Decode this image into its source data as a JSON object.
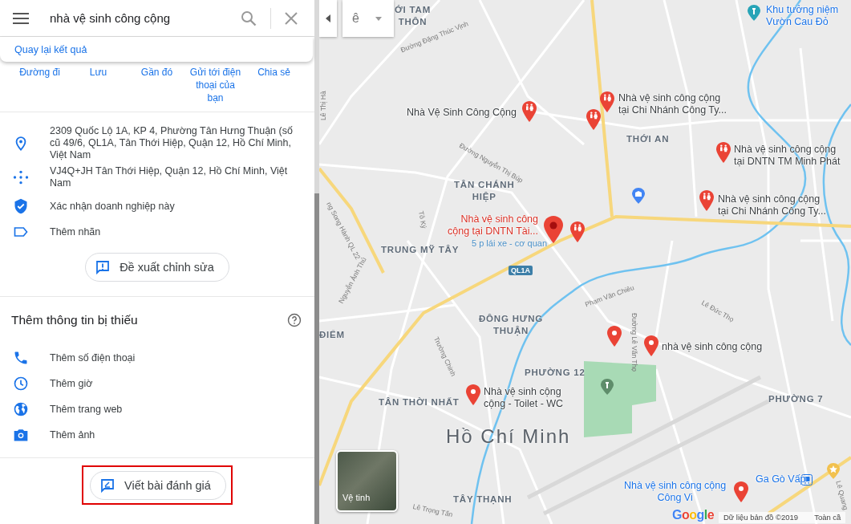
{
  "search": {
    "value": "nhà vệ sinh công cộng"
  },
  "back_link": "Quay lại kết quả",
  "actions": [
    "Đường đi",
    "Lưu",
    "Gần đó",
    "Gửi tới điện thoại của bạn",
    "Chia sẻ"
  ],
  "info_rows": [
    {
      "kind": "address",
      "text": "2309 Quốc Lộ 1A, KP 4, Phường Tân Hưng Thuận (số cũ 49/6, QL1A, Tân Thới Hiệp, Quận 12, Hồ Chí Minh, Việt Nam"
    },
    {
      "kind": "plus_code",
      "text": "VJ4Q+JH Tân Thới Hiệp, Quận 12, Hồ Chí Minh, Việt Nam"
    },
    {
      "kind": "verify",
      "text": "Xác nhận doanh nghiệp này"
    },
    {
      "kind": "label",
      "text": "Thêm nhãn"
    }
  ],
  "suggest_edit_button": "Đề xuất chỉnh sửa",
  "missing_info": {
    "title": "Thêm thông tin bị thiếu",
    "items": [
      {
        "kind": "phone",
        "label": "Thêm số điện thoại"
      },
      {
        "kind": "hours",
        "label": "Thêm giờ"
      },
      {
        "kind": "website",
        "label": "Thêm trang web"
      },
      {
        "kind": "photo",
        "label": "Thêm ảnh"
      }
    ]
  },
  "review_button": "Viết bài đánh giá",
  "map": {
    "input_tool": "ê",
    "areas": [
      {
        "lines": [
          "ỚI TAM",
          "THÔN"
        ]
      },
      {
        "lines": [
          "THỚI AN"
        ]
      },
      {
        "lines": [
          "TÂN CHÁNH",
          "HIỆP"
        ]
      },
      {
        "lines": [
          "TRUNG MỸ TÂY"
        ]
      },
      {
        "lines": [
          "ĐIỂM"
        ]
      },
      {
        "lines": [
          "ĐÔNG HƯNG",
          "THUẬN"
        ]
      },
      {
        "lines": [
          "PHƯỜNG 12"
        ]
      },
      {
        "lines": [
          "TÂN THỜI NHẤT"
        ]
      },
      {
        "lines": [
          "PHƯỜNG 7"
        ]
      },
      {
        "lines": [
          "TÂY THẠNH"
        ]
      }
    ],
    "city": "Hồ Chí Minh",
    "streets": [
      "Đường Đặng Thúc Vịnh",
      "Lê Thị Hà",
      "Đường Nguyễn Thị Búp",
      "Tô Ký",
      "ng Song Hành QL 22",
      "Nguyễn Ảnh Thủ",
      "Trường Chinh",
      "Phạm Văn Chiêu",
      "Đường Lê Văn Thọ",
      "Lê Đức Thọ",
      "Lê Trọng Tấn",
      "Lê Quang"
    ],
    "highway_shield": "QL1A",
    "places": [
      {
        "kind": "toilet",
        "selected": false,
        "lines": [
          "Nhà Vệ Sinh Công Cộng"
        ],
        "color": "#3c4043"
      },
      {
        "kind": "toilet",
        "selected": false
      },
      {
        "kind": "toilet",
        "selected": false,
        "lines": [
          "Nhà vệ sinh công cộng",
          "tại Chi Nhánh Công Ty..."
        ],
        "color": "#3c4043"
      },
      {
        "kind": "toilet",
        "selected": false,
        "lines": [
          "Nhà vệ sinh công cộng",
          "tại DNTN TM Minh Phát"
        ],
        "color": "#3c4043"
      },
      {
        "kind": "toilet",
        "selected": false,
        "lines": [
          "Nhà vệ sinh công cộng",
          "tại Chi Nhánh Công Ty..."
        ],
        "color": "#3c4043"
      },
      {
        "kind": "dot",
        "selected": true,
        "lines": [
          "Nhà vệ sinh công",
          "cộng tại DNTN Tài..."
        ],
        "color": "#d93025",
        "note": "5 p lái xe - cơ quan"
      },
      {
        "kind": "toilet",
        "selected": false
      },
      {
        "kind": "dot",
        "selected": false
      },
      {
        "kind": "dot",
        "selected": false,
        "lines": [
          "nhà vệ sinh công cộng"
        ],
        "color": "#3c4043"
      },
      {
        "kind": "dot",
        "selected": false,
        "lines": [
          "Nhà vệ sinh cộng",
          "cộng - Toilet - WC"
        ],
        "color": "#3c4043"
      },
      {
        "kind": "dot",
        "selected": false,
        "lines": [
          "Nhà vệ sinh công cộng",
          "Công Vi"
        ],
        "color": "#1a73e8"
      },
      {
        "kind": "info",
        "selected": false
      },
      {
        "kind": "park",
        "selected": false
      },
      {
        "kind": "landmark",
        "selected": false,
        "lines": [
          "Khu tưởng niệm",
          "Vườn Cau Đỏ"
        ],
        "color": "#1a73e8"
      },
      {
        "kind": "station",
        "selected": false,
        "lines": [
          "Ga Gò Vấp"
        ],
        "color": "#1a73e8"
      },
      {
        "kind": "star",
        "selected": false
      }
    ],
    "satellite_label": "Vệ tinh",
    "logo": "Google",
    "footer": [
      "Dữ liệu bản đồ ©2019",
      "Toàn cầ"
    ]
  }
}
